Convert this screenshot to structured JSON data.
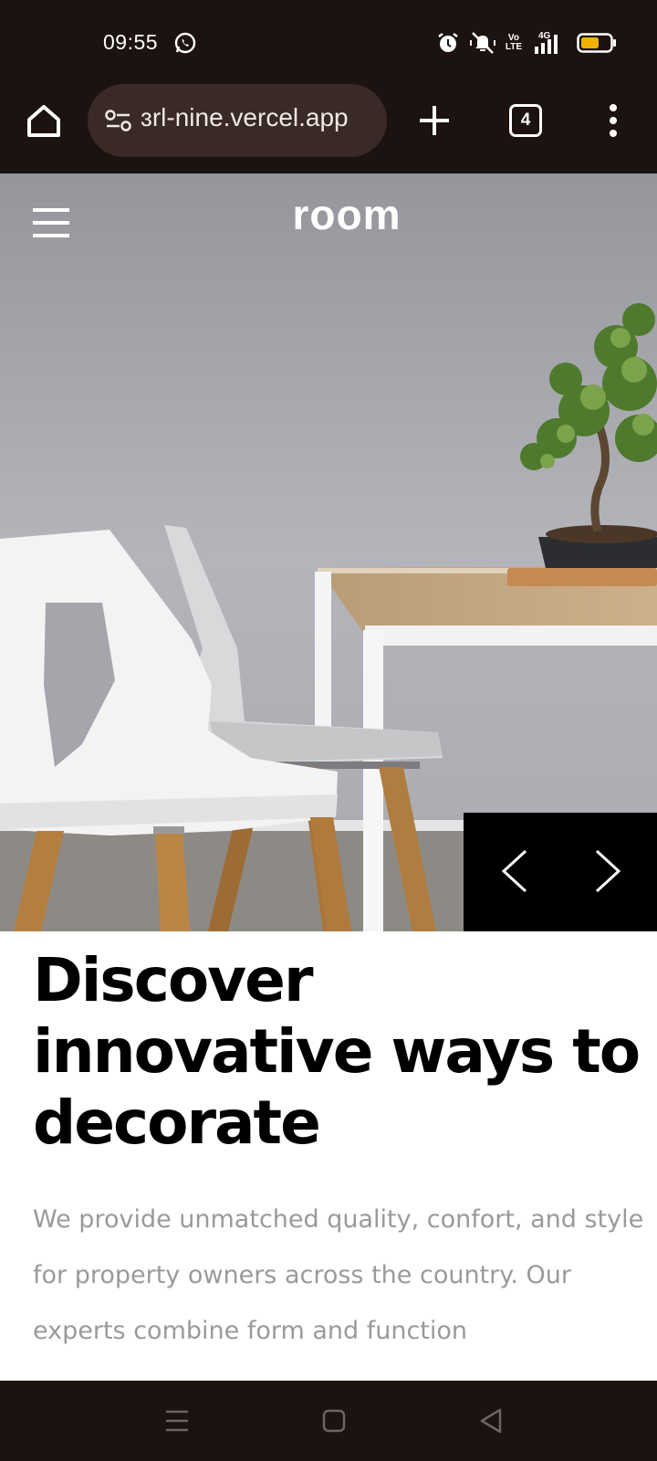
{
  "status_bar": {
    "time": "09:55",
    "network": "4G",
    "volte": "Vo\nLTE",
    "battery_color": "#f0b400"
  },
  "browser": {
    "url": "ɜrl-nine.vercel.app",
    "tab_count": "4",
    "icons": [
      "home-icon",
      "site-settings-icon",
      "new-tab-icon",
      "tab-switcher-icon",
      "more-options-icon"
    ]
  },
  "site": {
    "logo": "room",
    "hero": {
      "image_alt": "white chairs with wooden legs next to a table with a bonsai tree",
      "prev_icon": "chevron-left-icon",
      "next_icon": "chevron-right-icon"
    },
    "headline": "Discover innovative ways to decorate",
    "description": "We provide unmatched quality, confort, and style for property owners across the country. Our experts combine form and function"
  },
  "nav_bar": {
    "icons": [
      "recents-icon",
      "home-icon",
      "back-icon"
    ]
  },
  "colors": {
    "system_bar": "#1c1210",
    "url_pill": "#3a2a25",
    "headline": "#000000",
    "description": "#9a9a9a"
  }
}
